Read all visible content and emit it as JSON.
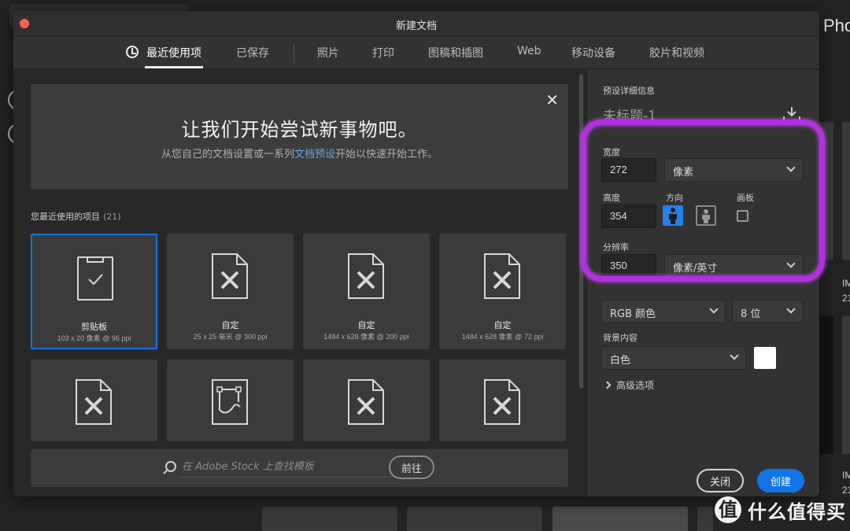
{
  "background": {
    "app_name_partial": "Pho",
    "side_labels": [
      "IM",
      "21",
      "IM",
      "21"
    ]
  },
  "dialog": {
    "title": "新建文档",
    "tabs": [
      {
        "label": "最近使用项",
        "active": true
      },
      {
        "label": "已保存"
      },
      {
        "label": "照片"
      },
      {
        "label": "打印"
      },
      {
        "label": "图稿和插图"
      },
      {
        "label": "Web"
      },
      {
        "label": "移动设备"
      },
      {
        "label": "胶片和视频"
      }
    ],
    "welcome": {
      "title": "让我们开始尝试新事物吧。",
      "subtitle_before": "从您自己的文档设置或一系列",
      "subtitle_link": "文档预设",
      "subtitle_after": "开始以快速开始工作。"
    },
    "recent": {
      "label": "您最近使用的项目",
      "count": "(21)",
      "items": [
        {
          "name": "剪贴板",
          "meta": "103 x 20 像素 @ 96 ppi",
          "icon": "clipboard-icon",
          "selected": true
        },
        {
          "name": "自定",
          "meta": "25 x 25 毫米 @ 300 ppi",
          "icon": "document-pencil-icon"
        },
        {
          "name": "自定",
          "meta": "1484 x 628 像素 @ 200 ppi",
          "icon": "document-pencil-icon"
        },
        {
          "name": "自定",
          "meta": "1484 x 628 像素 @ 72 ppi",
          "icon": "document-pencil-icon"
        },
        {
          "icon": "document-pencil-icon"
        },
        {
          "icon": "artboard-path-icon"
        },
        {
          "icon": "document-pencil-icon"
        },
        {
          "icon": "document-pencil-icon"
        }
      ]
    },
    "stock": {
      "placeholder": "在 Adobe Stock 上查找模板",
      "go_label": "前往"
    },
    "preset": {
      "section_label": "预设详细信息",
      "doc_name": "未标题-1",
      "width_label": "宽度",
      "width_value": "272",
      "width_unit": "像素",
      "height_label": "高度",
      "height_value": "354",
      "orientation_label": "方向",
      "orientation": "portrait",
      "artboard_label": "画板",
      "artboard_checked": false,
      "resolution_label": "分辨率",
      "resolution_value": "350",
      "resolution_unit": "像素/英寸",
      "color_mode": "RGB 颜色",
      "bit_depth": "8 位",
      "background_label": "背景内容",
      "background_value": "白色",
      "background_color": "#ffffff",
      "advanced_label": "高级选项"
    },
    "buttons": {
      "close": "关闭",
      "create": "创建"
    }
  },
  "annotation": {
    "highlight_color": "#b32fe3"
  },
  "watermark": {
    "logo": "值",
    "text": "什么值得买"
  },
  "colors": {
    "accent": "#1473e6",
    "link": "#6aa7e6"
  }
}
